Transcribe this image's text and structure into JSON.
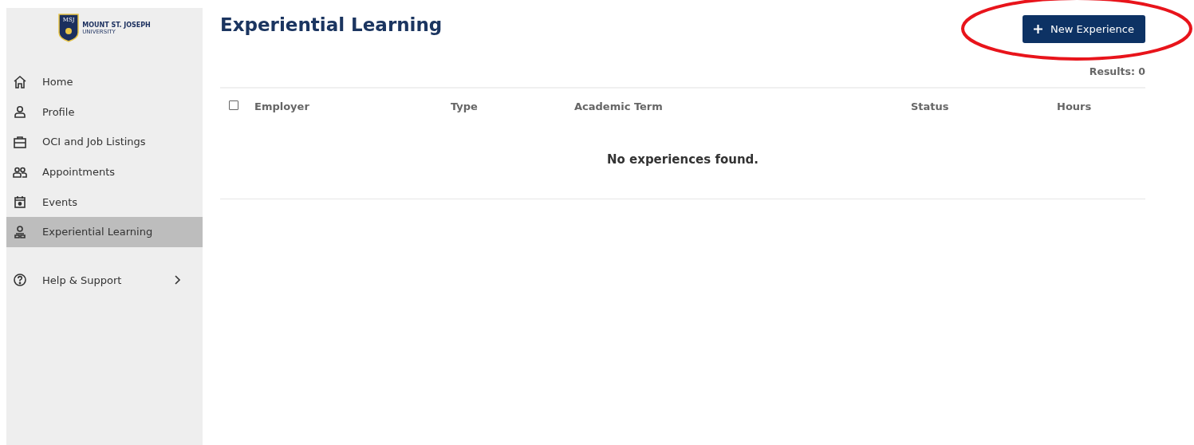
{
  "logo": {
    "monogram": "MSJ",
    "name": "MOUNT ST. JOSEPH",
    "subname": "UNIVERSITY"
  },
  "sidebar": {
    "items": [
      {
        "label": "Home",
        "kind": "home",
        "selected": false
      },
      {
        "label": "Profile",
        "kind": "person",
        "selected": false
      },
      {
        "label": "OCI and Job Listings",
        "kind": "briefcase",
        "selected": false
      },
      {
        "label": "Appointments",
        "kind": "people",
        "selected": false
      },
      {
        "label": "Events",
        "kind": "calendar",
        "selected": false
      },
      {
        "label": "Experiential Learning",
        "kind": "learner",
        "selected": true
      }
    ],
    "help": {
      "label": "Help & Support",
      "expanded": false
    }
  },
  "page": {
    "title": "Experiential Learning",
    "new_button": "New Experience",
    "highlighted": true,
    "results": "Results: 0"
  },
  "table": {
    "select_all_checked": false,
    "columns": [
      "Employer",
      "Type",
      "Academic Term",
      "Status",
      "Hours"
    ],
    "empty_message": "No experiences found."
  }
}
